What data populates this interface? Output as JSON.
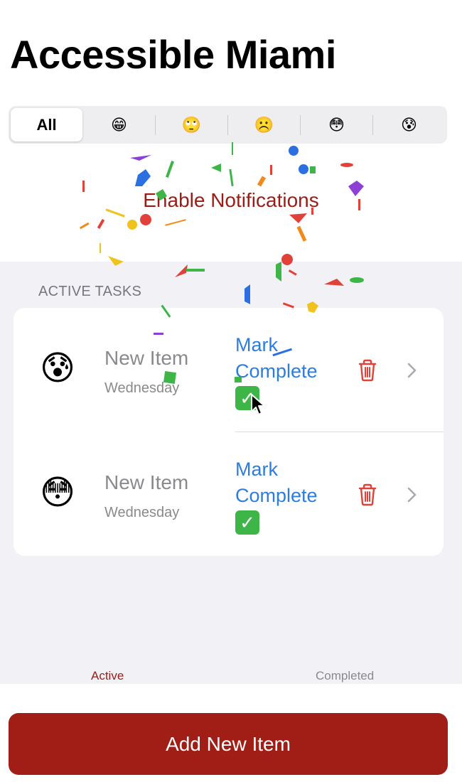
{
  "app": {
    "title": "Accessible Miami"
  },
  "filter": {
    "segments": [
      {
        "label": "All",
        "icon": "all-label"
      },
      {
        "label": "😁",
        "icon": "grinning-face-icon"
      },
      {
        "label": "🙄",
        "icon": "rolling-eyes-face-icon"
      },
      {
        "label": "☹️",
        "icon": "frowning-face-icon"
      },
      {
        "label": "😳",
        "icon": "flushed-face-icon"
      },
      {
        "label": "😰",
        "icon": "anxious-sweat-face-icon"
      }
    ],
    "selected": "All"
  },
  "notifications": {
    "label": "Enable Notifications"
  },
  "section": {
    "header": "ACTIVE TASKS"
  },
  "tasks": [
    {
      "emoji": "😰",
      "title": "New Item",
      "day": "Wednesday",
      "mark_label": "Mark Complete",
      "check": "✓"
    },
    {
      "emoji": "😳",
      "title": "New Item",
      "day": "Wednesday",
      "mark_label": "Mark Complete",
      "check": "✓"
    }
  ],
  "tabs": {
    "active": "Active",
    "completed": "Completed"
  },
  "footer": {
    "add_label": "Add New Item"
  },
  "colors": {
    "accent_red": "#a01e16",
    "link_blue": "#2b7de0",
    "check_green": "#3db547",
    "grouped_background": "#f2f1f6"
  }
}
